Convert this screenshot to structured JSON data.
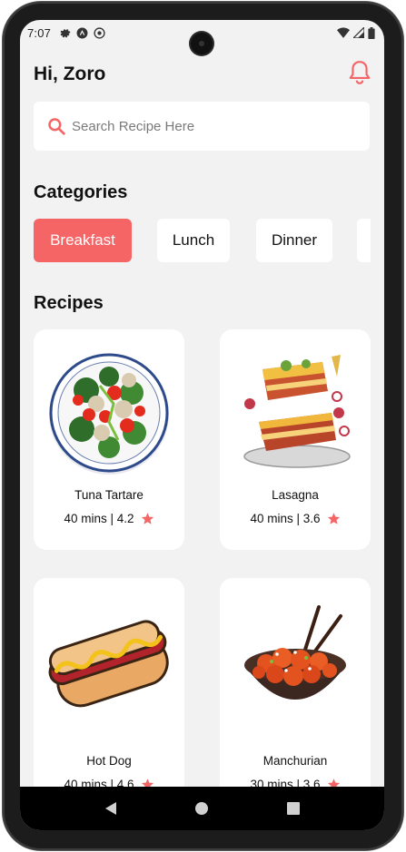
{
  "status_bar": {
    "time": "7:07",
    "left_icons": [
      "gear-icon",
      "android-icon",
      "sync-icon"
    ],
    "right_icons": [
      "wifi-icon",
      "signal-icon",
      "battery-icon"
    ]
  },
  "header": {
    "greeting": "Hi, Zoro",
    "notification_icon": "bell-icon"
  },
  "search": {
    "placeholder": "Search Recipe Here",
    "value": ""
  },
  "categories": {
    "title": "Categories",
    "items": [
      {
        "label": "Breakfast",
        "active": true
      },
      {
        "label": "Lunch",
        "active": false
      },
      {
        "label": "Dinner",
        "active": false
      }
    ]
  },
  "recipes": {
    "title": "Recipes",
    "items": [
      {
        "name": "Tuna Tartare",
        "meta": "40 mins | 4.2",
        "image": "salad-plate"
      },
      {
        "name": "Lasagna",
        "meta": "40 mins | 3.6",
        "image": "lasagna"
      },
      {
        "name": "Hot Dog",
        "meta": "40 mins | 4.6",
        "image": "hot-dog"
      },
      {
        "name": "Manchurian",
        "meta": "30 mins | 3.6",
        "image": "manchurian-bowl"
      }
    ]
  },
  "colors": {
    "accent": "#f56565",
    "background": "#f2f2f2",
    "card": "#ffffff"
  },
  "nav_bar": {
    "buttons": [
      "back",
      "home",
      "recents"
    ]
  }
}
